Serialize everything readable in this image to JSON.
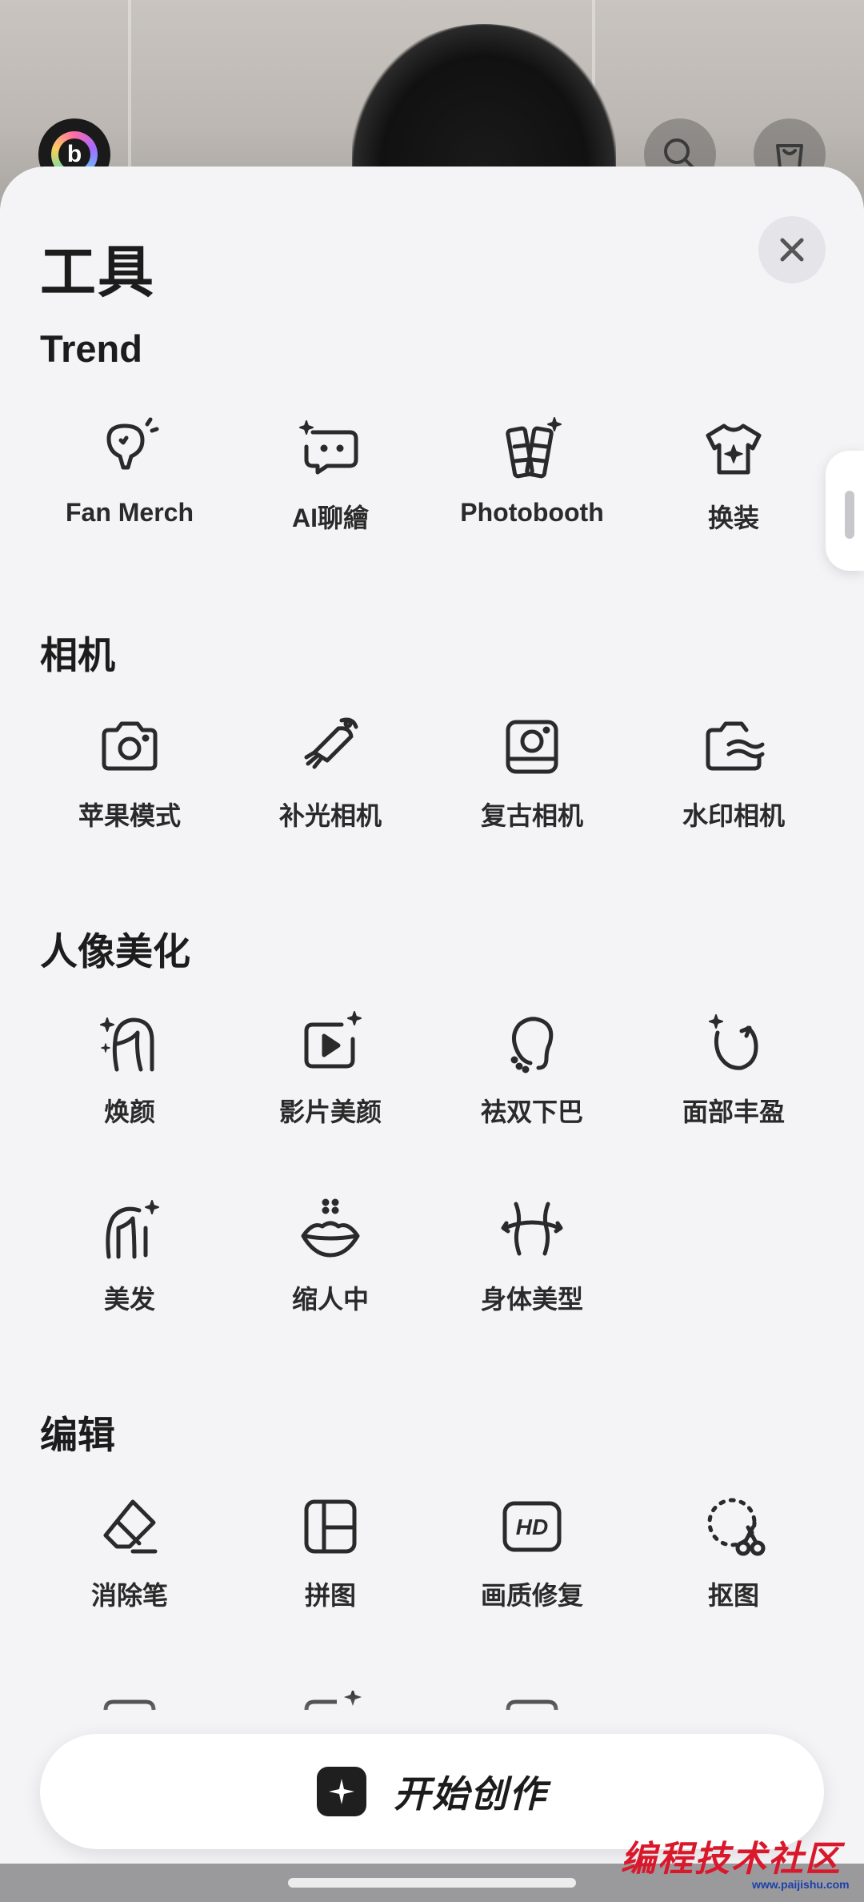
{
  "sheet": {
    "title": "工具",
    "close_icon": "close-icon"
  },
  "sections": [
    {
      "title": "Trend",
      "tools": [
        {
          "label": "Fan Merch",
          "icon": "fan-merch-icon"
        },
        {
          "label": "AI聊繪",
          "icon": "ai-chat-icon"
        },
        {
          "label": "Photobooth",
          "icon": "photobooth-icon"
        },
        {
          "label": "换装",
          "icon": "outfit-icon"
        }
      ]
    },
    {
      "title": "相机",
      "tools": [
        {
          "label": "苹果模式",
          "icon": "camera-icon"
        },
        {
          "label": "补光相机",
          "icon": "fill-light-icon"
        },
        {
          "label": "复古相机",
          "icon": "retro-camera-icon"
        },
        {
          "label": "水印相机",
          "icon": "watermark-camera-icon"
        }
      ]
    },
    {
      "title": "人像美化",
      "tools": [
        {
          "label": "焕颜",
          "icon": "face-glow-icon"
        },
        {
          "label": "影片美颜",
          "icon": "video-beauty-icon"
        },
        {
          "label": "祛双下巴",
          "icon": "double-chin-icon"
        },
        {
          "label": "面部丰盈",
          "icon": "face-plump-icon"
        },
        {
          "label": "美发",
          "icon": "hair-icon"
        },
        {
          "label": "缩人中",
          "icon": "lips-icon"
        },
        {
          "label": "身体美型",
          "icon": "body-shape-icon"
        }
      ]
    },
    {
      "title": "编辑",
      "tools": [
        {
          "label": "消除笔",
          "icon": "eraser-icon"
        },
        {
          "label": "拼图",
          "icon": "collage-icon"
        },
        {
          "label": "画质修复",
          "icon": "hd-icon"
        },
        {
          "label": "抠图",
          "icon": "cutout-icon"
        }
      ]
    }
  ],
  "hd_badge_text": "HD",
  "create_button": {
    "label": "开始创作",
    "icon": "sparkle-icon"
  },
  "watermark": {
    "text": "编程技术社区",
    "url": "www.paijishu.com"
  },
  "colors": {
    "sheet_bg": "#f4f4f7",
    "text": "#1c1c1c",
    "icon_stroke": "#2a2a2a"
  }
}
